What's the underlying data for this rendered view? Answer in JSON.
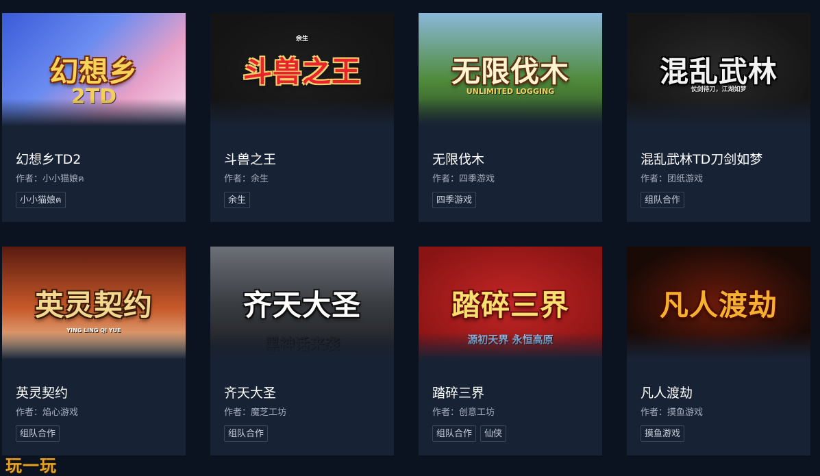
{
  "author_prefix": "作者：",
  "watermark": "玩一玩",
  "cards": [
    {
      "title": "幻想乡TD2",
      "author": "小小猫娘ฅ",
      "tags": [
        "小小猫娘ฅ"
      ],
      "cover": {
        "text": "幻想乡",
        "sub": "2TD",
        "colors": [
          "#3a5bd9",
          "#e8a0c8",
          "#f5c542"
        ]
      }
    },
    {
      "title": "斗兽之王",
      "author": "余生",
      "tags": [
        "余生"
      ],
      "cover": {
        "text": "斗兽之王",
        "sub": "余生",
        "colors": [
          "#141414",
          "#1d1d1d",
          "#d21f1f"
        ]
      }
    },
    {
      "title": "无限伐木",
      "author": "四季游戏",
      "tags": [
        "四季游戏"
      ],
      "cover": {
        "text": "无限伐木",
        "sub": "UNLIMITED LOGGING",
        "colors": [
          "#4f8a3a",
          "#8ab8d8",
          "#8b5a2b"
        ]
      }
    },
    {
      "title": "混乱武林TD刀剑如梦",
      "author": "团纸游戏",
      "tags": [
        "组队合作"
      ],
      "cover": {
        "text": "混乱武林",
        "sub": "仗剑待刀，江湖如梦",
        "colors": [
          "#161616",
          "#2a2a2a",
          "#c41a1a"
        ]
      }
    },
    {
      "title": "英灵契约",
      "author": "焰心游戏",
      "tags": [
        "组队合作"
      ],
      "cover": {
        "text": "英灵契约",
        "sub": "YING LING QI YUE",
        "colors": [
          "#5a1a10",
          "#c85a2a",
          "#e8c070"
        ]
      }
    },
    {
      "title": "齐天大圣",
      "author": "魔芝工坊",
      "tags": [
        "组队合作"
      ],
      "cover": {
        "text": "齐天大圣",
        "sub": "黑神话来袭",
        "colors": [
          "#3a3d42",
          "#6c7077",
          "#1a1c20"
        ]
      }
    },
    {
      "title": "踏碎三界",
      "author": "创意工坊",
      "tags": [
        "组队合作",
        "仙侠"
      ],
      "cover": {
        "text": "踏碎三界",
        "sub": "源初天界 永恒高原",
        "colors": [
          "#8a1414",
          "#c42626",
          "#e8b84a"
        ]
      }
    },
    {
      "title": "凡人渡劫",
      "author": "摸鱼游戏",
      "tags": [
        "摸鱼游戏"
      ],
      "cover": {
        "text": "凡人渡劫",
        "sub": "",
        "colors": [
          "#1a0a06",
          "#6a1a0a",
          "#f0a030"
        ]
      }
    }
  ]
}
